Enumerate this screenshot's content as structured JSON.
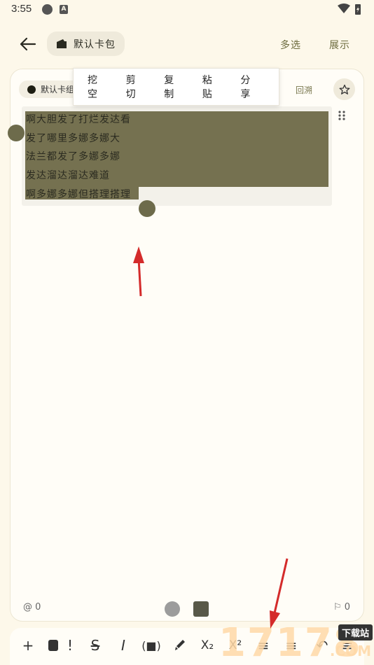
{
  "status_bar": {
    "time": "3:55",
    "icon_b_letter": "A"
  },
  "app_bar": {
    "wallet_label": "默认卡包",
    "multi_select": "多选",
    "display": "展示"
  },
  "card": {
    "tag_label": "默认卡组",
    "backtrack": "回溯",
    "lines": [
      "啊大胆发了打烂发达看",
      "发了哪里多娜多娜大",
      "法兰都发了多娜多娜",
      "发达溜达溜达难道",
      "啊多娜多娜但搭理搭理"
    ],
    "mention_count": "0",
    "bookmark_count": "0"
  },
  "context_menu": {
    "items": [
      "挖空",
      "剪切",
      "复制",
      "粘贴",
      "分享"
    ]
  },
  "toolbar": {
    "icons": [
      "plus-icon",
      "card-icon",
      "exclaim-icon",
      "strikethrough-icon",
      "italic-icon",
      "cloze-bracket-icon",
      "highlight-brush-icon",
      "subscript-icon",
      "superscript-icon",
      "align-icon",
      "indent-icon",
      "undo-icon",
      "menu-icon"
    ]
  },
  "watermark": {
    "digits": "17178",
    "badge": "下载站",
    "suffix": ".COM"
  },
  "colors": {
    "background": "#fdf8ea",
    "accent": "#6b6a3c",
    "selection": "#757150",
    "arrow": "#d42b2b"
  }
}
